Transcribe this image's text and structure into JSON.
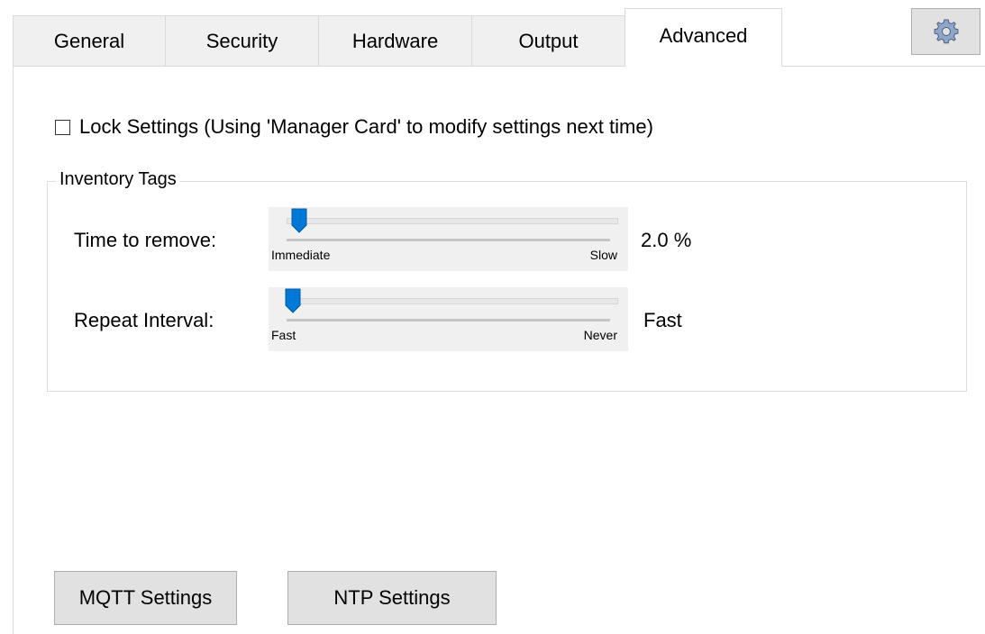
{
  "tabs": [
    {
      "label": "General",
      "active": false
    },
    {
      "label": "Security",
      "active": false
    },
    {
      "label": "Hardware",
      "active": false
    },
    {
      "label": "Output",
      "active": false
    },
    {
      "label": "Advanced",
      "active": true
    }
  ],
  "toolbar": {
    "settings_icon": "gear-icon"
  },
  "lock_settings": {
    "label": "Lock Settings (Using 'Manager Card' to modify settings next time)",
    "checked": false
  },
  "inventory_tags": {
    "title": "Inventory Tags",
    "time_to_remove": {
      "label": "Time to remove:",
      "min_label": "Immediate",
      "max_label": "Slow",
      "value_text": "2.0 %",
      "position": 0.02
    },
    "repeat_interval": {
      "label": "Repeat Interval:",
      "min_label": "Fast",
      "max_label": "Never",
      "value_text": "Fast",
      "position": 0.0
    }
  },
  "buttons": {
    "mqtt": "MQTT Settings",
    "ntp": "NTP Settings"
  },
  "colors": {
    "thumb": "#0078d7",
    "tab_bg": "#f0f0f0",
    "button_bg": "#e1e1e1"
  }
}
